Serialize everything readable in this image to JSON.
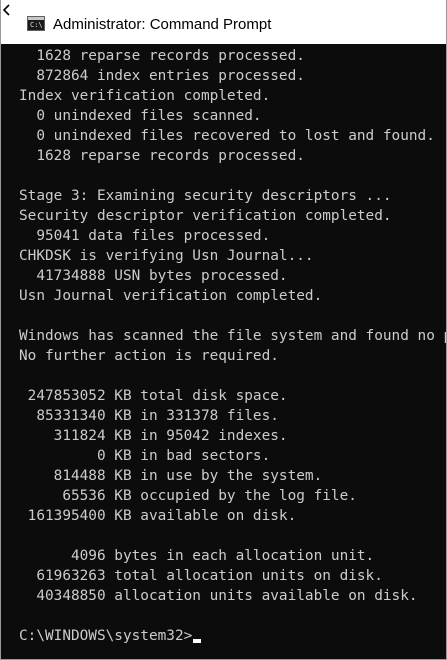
{
  "window": {
    "title": "Administrator: Command Prompt"
  },
  "console": {
    "lines": [
      "  1628 reparse records processed.",
      "  872864 index entries processed.",
      "Index verification completed.",
      "  0 unindexed files scanned.",
      "  0 unindexed files recovered to lost and found.",
      "  1628 reparse records processed.",
      "",
      "Stage 3: Examining security descriptors ...",
      "Security descriptor verification completed.",
      "  95041 data files processed.",
      "CHKDSK is verifying Usn Journal...",
      "  41734888 USN bytes processed.",
      "Usn Journal verification completed.",
      "",
      "Windows has scanned the file system and found no problems.",
      "No further action is required.",
      "",
      " 247853052 KB total disk space.",
      "  85331340 KB in 331378 files.",
      "    311824 KB in 95042 indexes.",
      "         0 KB in bad sectors.",
      "    814488 KB in use by the system.",
      "     65536 KB occupied by the log file.",
      " 161395400 KB available on disk.",
      "",
      "      4096 bytes in each allocation unit.",
      "  61963263 total allocation units on disk.",
      "  40348850 allocation units available on disk.",
      ""
    ],
    "prompt": "C:\\WINDOWS\\system32>"
  },
  "icons": {
    "window_icon": "command-prompt-icon",
    "back": "back-arrow-icon"
  }
}
